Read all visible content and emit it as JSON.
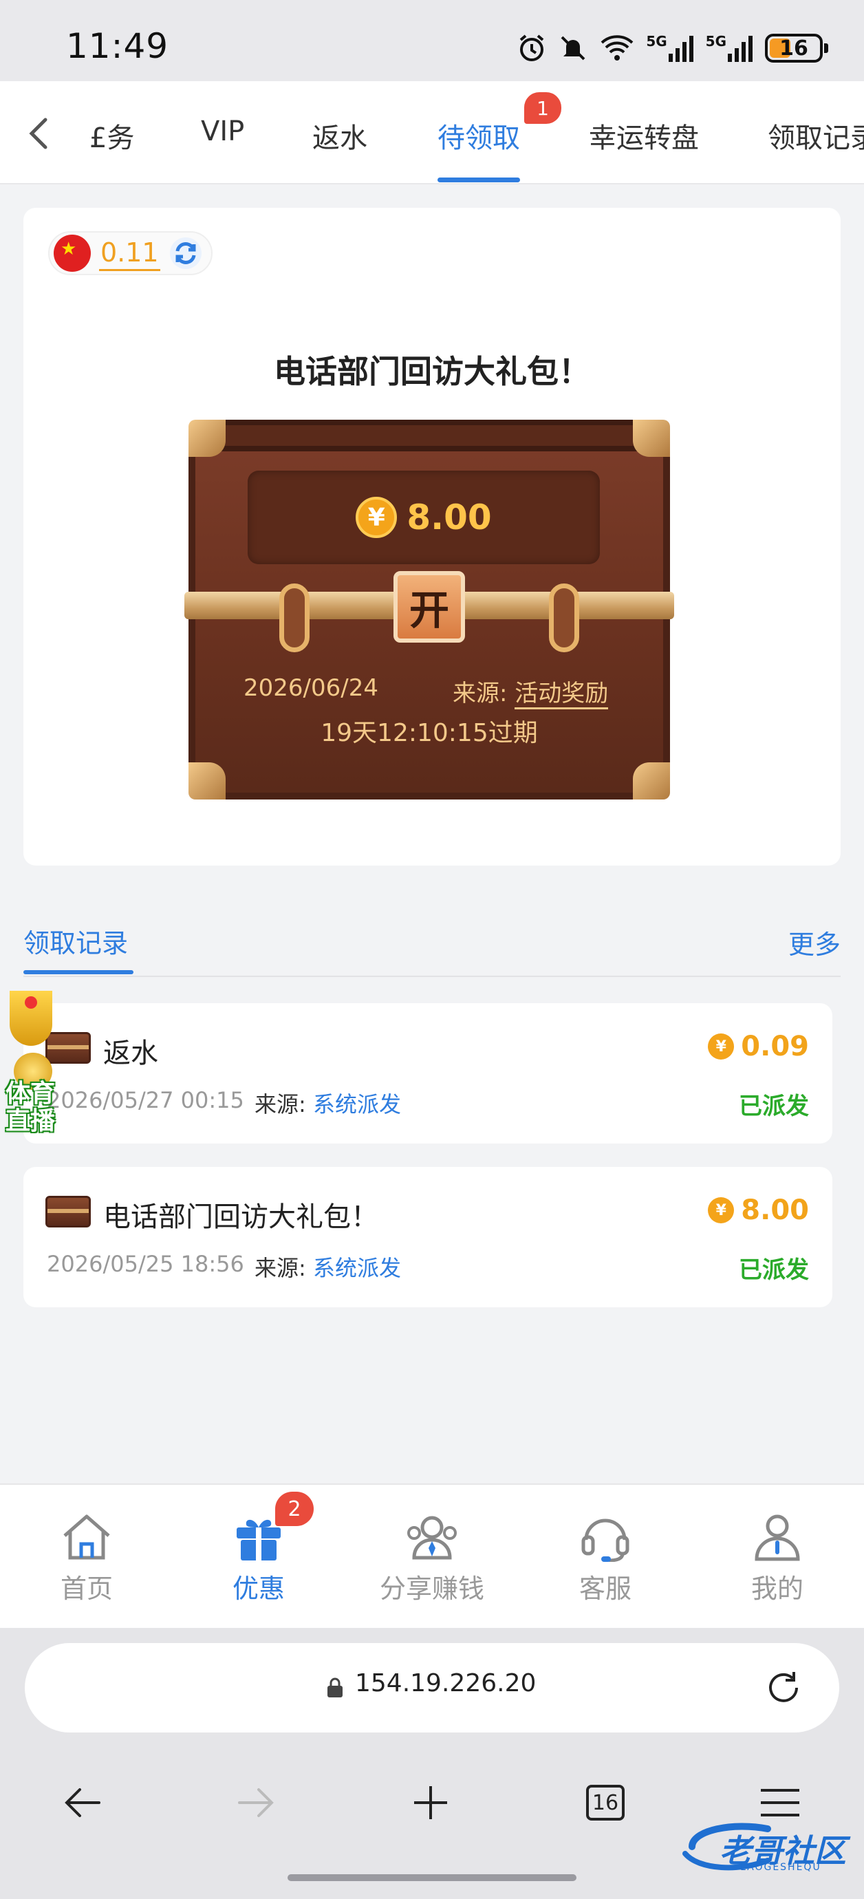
{
  "status_bar": {
    "time": "11:49",
    "net1": "5G",
    "net2": "5G",
    "battery": "16"
  },
  "tabs": {
    "items": [
      {
        "label": "£务"
      },
      {
        "label": "VIP"
      },
      {
        "label": "返水"
      },
      {
        "label": "待领取",
        "badge": "1",
        "active": true
      },
      {
        "label": "幸运转盘"
      },
      {
        "label": "领取记录"
      }
    ]
  },
  "balance": {
    "value": "0.11"
  },
  "package": {
    "title": "电话部门回访大礼包！",
    "coin_symbol": "¥",
    "amount": "8.00",
    "open_label": "开",
    "date": "2026/06/24",
    "source_label": "来源:",
    "source_value": "活动奖励",
    "expire": "19天12:10:15过期"
  },
  "records": {
    "tab_label": "领取记录",
    "more_label": "更多",
    "items": [
      {
        "name": "返水",
        "amount": "0.09",
        "date": "2026/05/27 00:15",
        "source_label": "来源:",
        "source_value": "系统派发",
        "status": "已派发"
      },
      {
        "name": "电话部门回访大礼包！",
        "amount": "8.00",
        "date": "2026/05/25 18:56",
        "source_label": "来源:",
        "source_value": "系统派发",
        "status": "已派发"
      }
    ]
  },
  "float_widget": {
    "line1": "体育",
    "line2": "直播"
  },
  "bottom_nav": {
    "items": [
      {
        "label": "首页",
        "icon": "home-icon"
      },
      {
        "label": "优惠",
        "icon": "gift-icon",
        "badge": "2",
        "active": true
      },
      {
        "label": "分享赚钱",
        "icon": "share-icon"
      },
      {
        "label": "客服",
        "icon": "headset-icon"
      },
      {
        "label": "我的",
        "icon": "user-icon"
      }
    ]
  },
  "browser": {
    "url": "154.19.226.20",
    "tab_count": "16"
  },
  "watermark": {
    "text": "老哥社区",
    "sub": "LAOGESHEQU"
  },
  "colors": {
    "accent": "#2f7ddf",
    "gold": "#f2a31a",
    "success": "#2bab2b",
    "badge": "#e94b3c"
  }
}
